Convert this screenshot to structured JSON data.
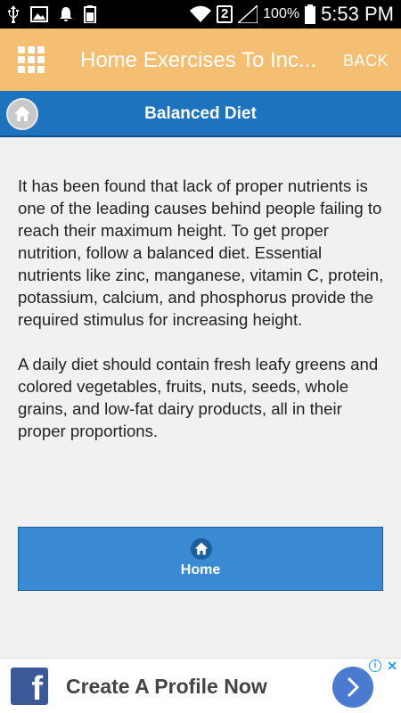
{
  "status_bar": {
    "battery_percent": "100%",
    "sim_label": "2",
    "time": "5:53 PM"
  },
  "app_bar": {
    "title": "Home Exercises To Inc...",
    "back_label": "BACK"
  },
  "section": {
    "heading": "Balanced Diet"
  },
  "content": {
    "paragraphs": [
      "It has been found that lack of proper nutrients is one of the leading causes behind people failing to reach their maximum height. To get proper nutrition, follow a balanced diet. Essential nutrients like zinc, manganese, vitamin C, protein, potassium, calcium, and phosphorus provide the required stimulus for increasing height.",
      "A daily diet should contain fresh leafy greens and colored vegetables, fruits, nuts, seeds, whole grains, and low-fat dairy products, all in their proper proportions."
    ]
  },
  "home_button": {
    "label": "Home"
  },
  "ad": {
    "text": "Create A Profile Now",
    "logo_letter": "f",
    "info_glyph": "i",
    "close_glyph": "✕"
  },
  "colors": {
    "app_bar": "#f4bf73",
    "section_header": "#1e73bf",
    "home_button": "#3a8ad3",
    "facebook": "#3b5998"
  }
}
